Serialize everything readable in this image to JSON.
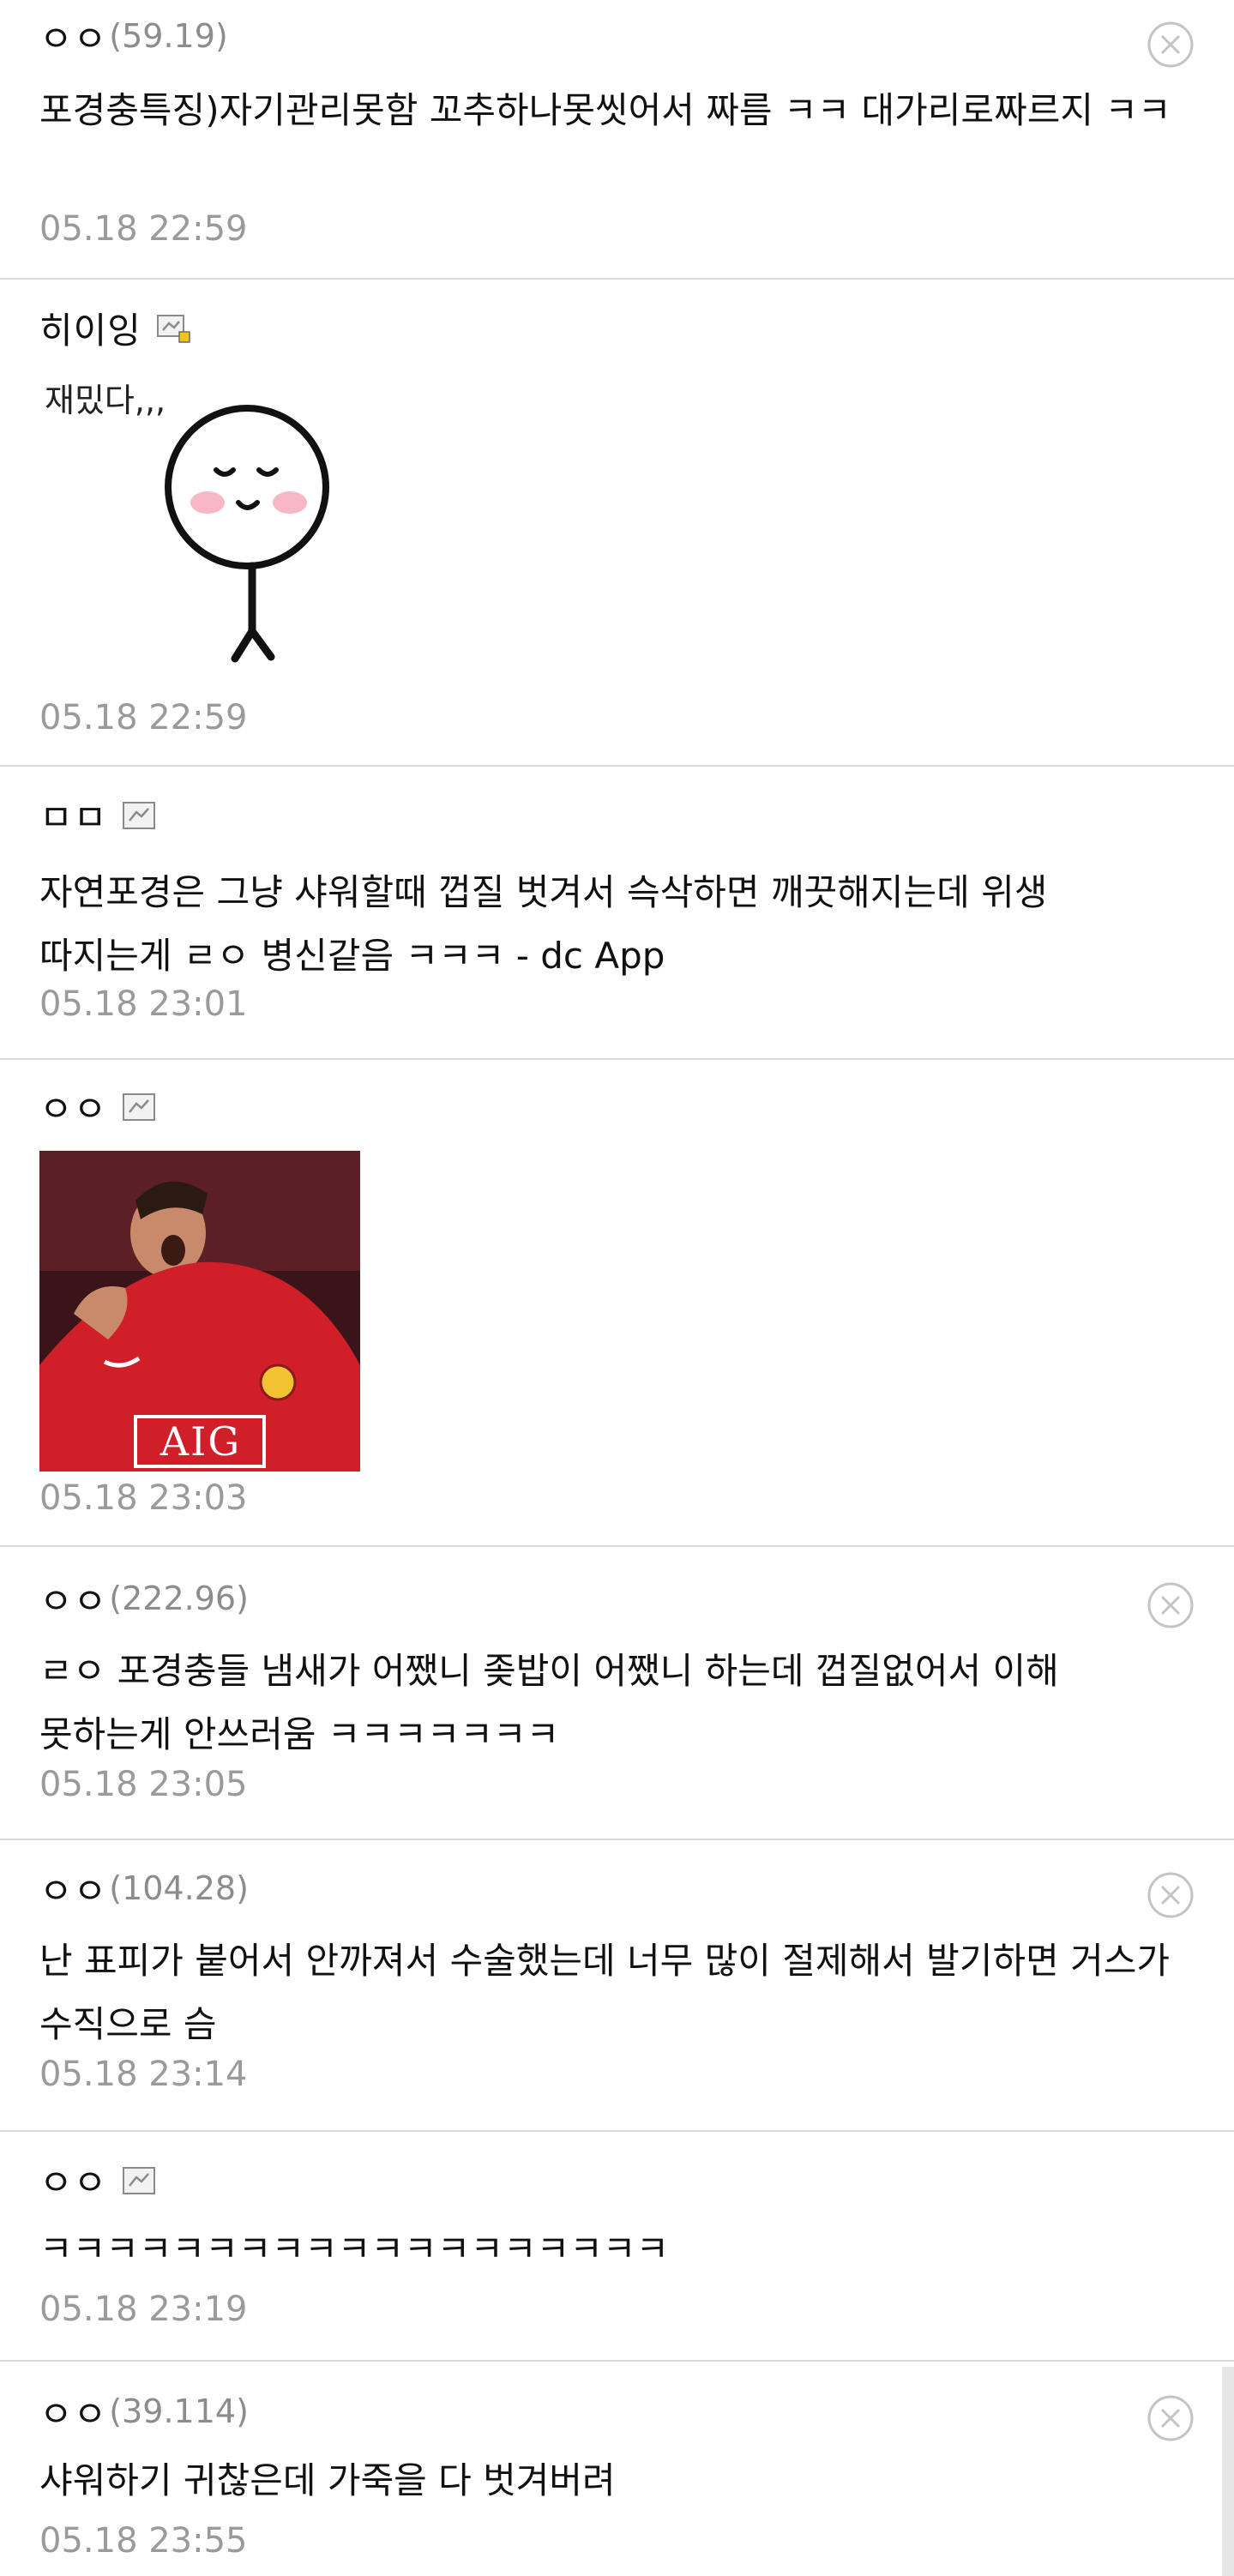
{
  "comments": [
    {
      "nickname": "ㅇㅇ",
      "ip": "(59.19)",
      "text": "포경충특징)자기관리못함 꼬추하나못씻어서 짜름 ㅋㅋ 대가리로짜르지 ㅋㅋ",
      "date": "05.18 22:59"
    },
    {
      "nickname": "히이잉",
      "dccon_caption": "재밌다,,,",
      "date": "05.18 22:59"
    },
    {
      "nickname": "ㅁㅁ",
      "text": "자연포경은 그냥 샤워할때 껍질 벗겨서 슥삭하면 깨끗해지는데 위생 따지는게 ㄹㅇ 병신같음 ㅋㅋㅋ - dc App",
      "date": "05.18 23:01"
    },
    {
      "nickname": "ㅇㅇ",
      "image_jersey_text": "AIG",
      "date": "05.18 23:03"
    },
    {
      "nickname": "ㅇㅇ",
      "ip": "(222.96)",
      "text": "ㄹㅇ 포경충들 냄새가 어쨌니 좆밥이 어쨌니 하는데 껍질없어서 이해 못하는게 안쓰러움 ㅋㅋㅋㅋㅋㅋㅋ",
      "date": "05.18 23:05"
    },
    {
      "nickname": "ㅇㅇ",
      "ip": "(104.28)",
      "text": "난 표피가 붙어서 안까져서 수술했는데 너무 많이 절제해서 발기하면 거스가 수직으로 슴",
      "date": "05.18 23:14"
    },
    {
      "nickname": "ㅇㅇ",
      "text": "ㅋㅋㅋㅋㅋㅋㅋㅋㅋㅋㅋㅋㅋㅋㅋㅋㅋㅋㅋ",
      "date": "05.18 23:19"
    },
    {
      "nickname": "ㅇㅇ",
      "ip": "(39.114)",
      "text": "샤워하기 귀찮은데 가죽을 다 벗겨버려",
      "date": "05.18 23:55"
    }
  ],
  "icons": {
    "delete": "close-circle-icon",
    "fixed_nick": "fixed-nick-icon",
    "half_fixed_nick": "half-fixed-nick-icon"
  },
  "colors": {
    "ip_text": "#8c8c8c",
    "date_text": "#9a9a9a",
    "divider": "#dadada",
    "delete_icon": "#c4c4c4",
    "jersey_red": "#d11f2a"
  }
}
